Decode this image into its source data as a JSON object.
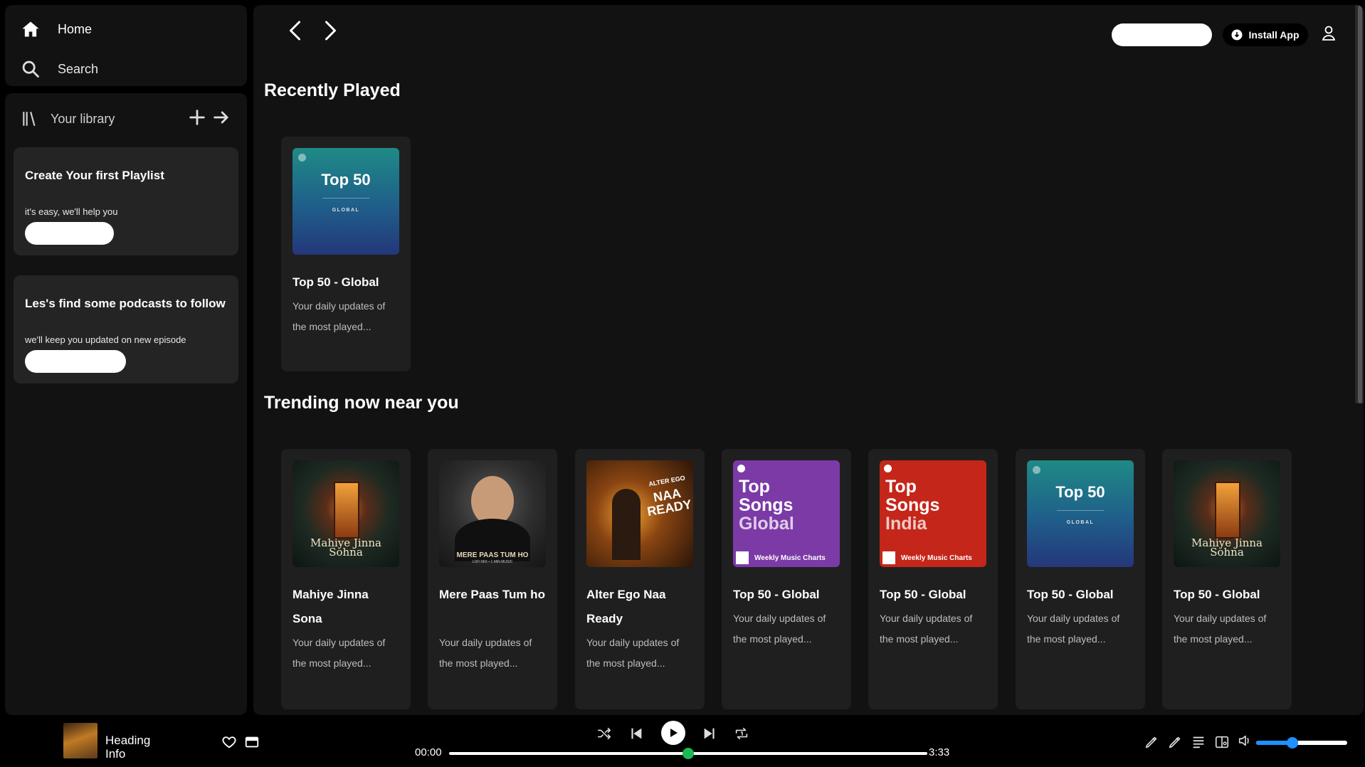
{
  "sidebar": {
    "home_label": "Home",
    "search_label": "Search",
    "library_label": "Your library",
    "promos": [
      {
        "title": "Create Your first Playlist",
        "text": "it's easy, we'll help you"
      },
      {
        "title": "Les's find some podcasts to follow",
        "text": "we'll keep you updated on new episode"
      }
    ]
  },
  "header": {
    "install_label": "Install App"
  },
  "sections": {
    "recent_title": "Recently Played",
    "trending_title": "Trending now near you"
  },
  "recent_cards": [
    {
      "title": "Top 50 - Global",
      "desc": "Your daily updates of the most played...",
      "art": "top50"
    }
  ],
  "trending_cards": [
    {
      "title": "Mahiye Jinna Sona",
      "desc": "Your daily updates of the most played...",
      "art": "mahiye"
    },
    {
      "title": "Mere Paas Tum ho",
      "desc": "Your daily updates of the most played...",
      "art": "merepaas"
    },
    {
      "title": "Alter Ego Naa Ready",
      "desc": "Your daily updates of the most played...",
      "art": "alterego"
    },
    {
      "title": "Top 50 - Global",
      "desc": "Your daily updates of the most played...",
      "art": "songs-global"
    },
    {
      "title": "Top 50 - Global",
      "desc": "Your daily updates of the most played...",
      "art": "songs-india"
    },
    {
      "title": "Top 50 - Global",
      "desc": "Your daily updates of the most played...",
      "art": "top50"
    },
    {
      "title": "Top 50 - Global",
      "desc": "Your daily updates of the most played...",
      "art": "mahiye"
    }
  ],
  "art_text": {
    "top50_title": "Top 50",
    "top50_sub": "GLOBAL",
    "songs_global": [
      "Top",
      "Songs",
      "Global"
    ],
    "songs_india": [
      "Top",
      "Songs",
      "India"
    ],
    "weekly": "Weekly Music Charts",
    "mahiye": "Mahiye Jinna Sohna",
    "merepaas": "MERE PAAS TUM HO",
    "merepaas_sub": "LOFI MIX • 1 MIN MUSIC",
    "alterego": "NAA READY",
    "alterego_top": "ALTER EGO"
  },
  "player": {
    "track_title": "Heading",
    "track_sub": "Info",
    "time_current": "00:00",
    "time_total": "3:33",
    "progress_fraction": 0.5,
    "volume_fraction": 0.4
  },
  "colors": {
    "accent_progress": "#1db954",
    "accent_volume": "#1e90ff",
    "songs_global_bg": "#7b3aa6",
    "songs_india_bg": "#c4261a"
  }
}
